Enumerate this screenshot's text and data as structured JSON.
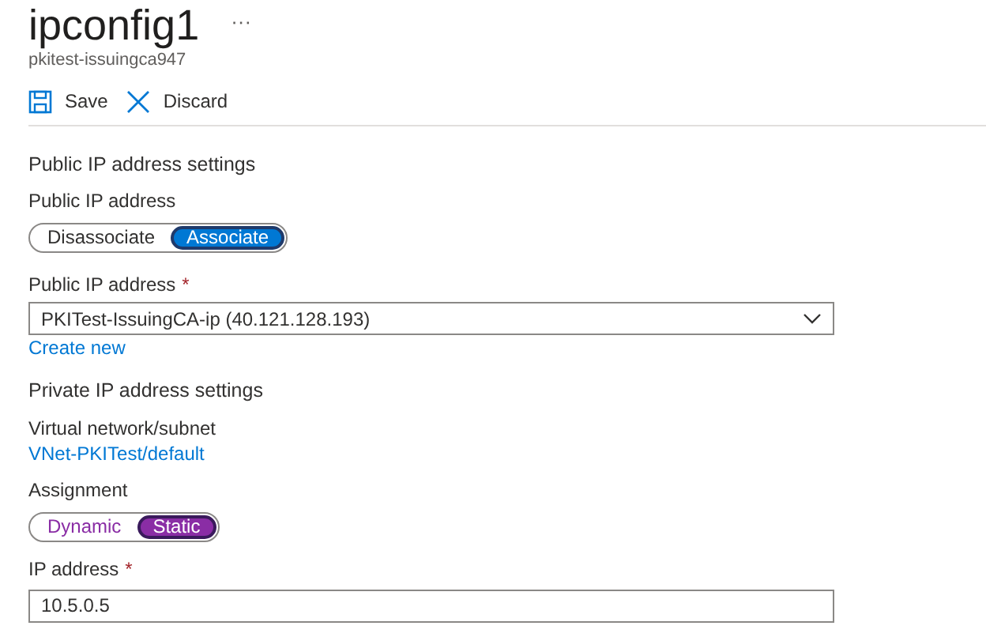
{
  "header": {
    "title": "ipconfig1",
    "more": "···",
    "subtitle": "pkitest-issuingca947"
  },
  "toolbar": [
    {
      "kind": "save",
      "label": "Save"
    },
    {
      "kind": "discard",
      "label": "Discard"
    }
  ],
  "sections": [
    {
      "heading": "Public IP address settings",
      "fields": [
        {
          "kind": "toggle",
          "label": "Public IP address",
          "modified": false,
          "options": [
            {
              "label": "Disassociate",
              "selected": false
            },
            {
              "label": "Associate",
              "selected": true
            }
          ]
        },
        {
          "kind": "dropdown",
          "label": "Public IP address",
          "required_mark": "*",
          "value": "PKITest-IssuingCA-ip (40.121.128.193)",
          "link": "Create new"
        }
      ]
    },
    {
      "heading": "Private IP address settings",
      "fields": [
        {
          "kind": "link",
          "label": "Virtual network/subnet",
          "value": "VNet-PKITest/default"
        },
        {
          "kind": "toggle",
          "label": "Assignment",
          "modified": true,
          "options": [
            {
              "label": "Dynamic",
              "selected": false
            },
            {
              "label": "Static",
              "selected": true
            }
          ]
        },
        {
          "kind": "input",
          "label": "IP address",
          "required_mark": "*",
          "value": "10.5.0.5"
        }
      ]
    }
  ]
}
